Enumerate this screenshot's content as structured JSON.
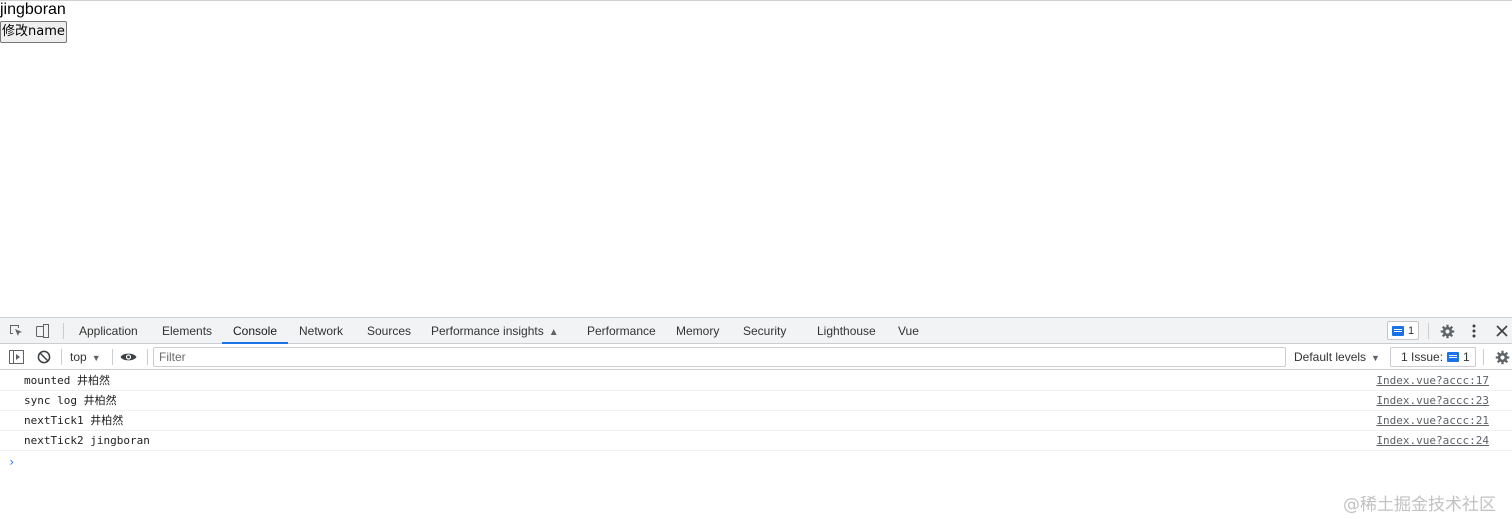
{
  "page": {
    "name_text": "jingboran",
    "button_label": "修改name"
  },
  "devtools": {
    "tabs": [
      {
        "label": "Application",
        "active": false
      },
      {
        "label": "Elements",
        "active": false
      },
      {
        "label": "Console",
        "active": true
      },
      {
        "label": "Network",
        "active": false
      },
      {
        "label": "Sources",
        "active": false
      },
      {
        "label": "Performance insights",
        "active": false,
        "experimental_icon": "flask-icon"
      },
      {
        "label": "Performance",
        "active": false
      },
      {
        "label": "Memory",
        "active": false
      },
      {
        "label": "Security",
        "active": false
      },
      {
        "label": "Lighthouse",
        "active": false
      },
      {
        "label": "Vue",
        "active": false
      }
    ],
    "messages_badge_count": "1",
    "toolbar": {
      "context": "top",
      "filter_placeholder": "Filter",
      "levels_label": "Default levels",
      "issues_label": "1 Issue:",
      "issues_count": "1"
    },
    "logs": [
      {
        "message": "mounted 井柏然",
        "source": "Index.vue?accc:17"
      },
      {
        "message": "sync log 井柏然",
        "source": "Index.vue?accc:23"
      },
      {
        "message": "nextTick1 井柏然",
        "source": "Index.vue?accc:21"
      },
      {
        "message": "nextTick2 jingboran",
        "source": "Index.vue?accc:24"
      }
    ],
    "prompt_symbol": "›",
    "accent_color": "#1a73e8"
  },
  "watermark": "@稀土掘金技术社区"
}
